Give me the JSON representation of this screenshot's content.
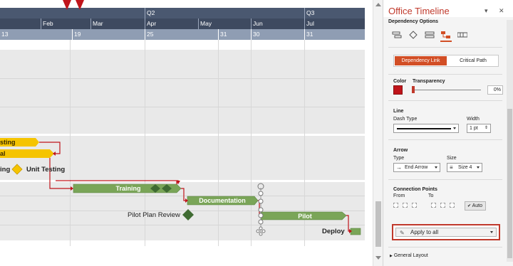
{
  "timeline": {
    "quarters": [
      "Q2",
      "Q3"
    ],
    "months": [
      "Feb",
      "Mar",
      "Apr",
      "May",
      "Jun",
      "Jul"
    ],
    "weeks": [
      "13",
      "19",
      "25",
      "31",
      "30",
      "31"
    ]
  },
  "tasks": {
    "testing_label": "sting",
    "al_label": "al",
    "ing_label": "ing",
    "unit_testing": "Unit Testing",
    "training": "Training",
    "documentation": "Documentation",
    "pilot_plan_review": "Pilot Plan Review",
    "pilot": "Pilot",
    "deploy": "Deploy"
  },
  "panel": {
    "title": "Office Timeline",
    "dropdown_glyph": "▾",
    "close_glyph": "✕",
    "section_title": "Dependency Options",
    "tabs": {
      "active": "Dependency Link",
      "inactive": "Critical Path"
    },
    "color_label": "Color",
    "transparency_label": "Transparency",
    "transparency_value": "0%",
    "line_label": "Line",
    "dash_type_label": "Dash Type",
    "width_label": "Width",
    "width_value": "1 pt",
    "arrow_label": "Arrow",
    "type_label": "Type",
    "size_label": "Size",
    "arrow_type_value": "End Arrow",
    "arrow_size_value": "Size 4",
    "connection_points_label": "Connection Points",
    "from_label": "From",
    "to_label": "To",
    "auto_label": "Auto",
    "apply_label": "Apply to all",
    "general_layout_label": "General Layout"
  },
  "colors": {
    "accent": "#c0392b",
    "dependency_color": "#c0141b",
    "header_dark": "#3e4a60",
    "header_light": "#8f9db3",
    "green_bar": "#7aa558",
    "yellow_bar": "#f5c400",
    "diamond_green": "#4a7a3a"
  }
}
